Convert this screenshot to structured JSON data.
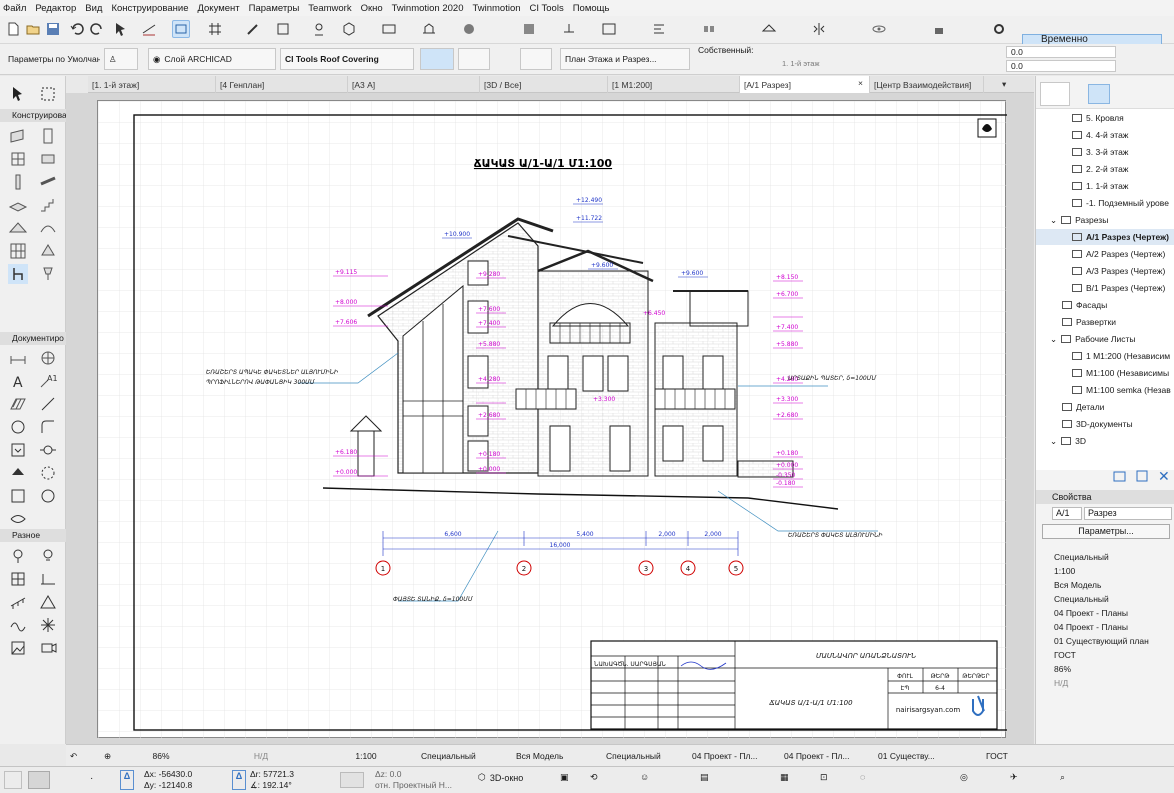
{
  "menu": [
    "Файл",
    "Редактор",
    "Вид",
    "Конструирование",
    "Документ",
    "Параметры",
    "Teamwork",
    "Окно",
    "Twinmotion 2020",
    "Twinmotion",
    "CI Tools",
    "Помощь"
  ],
  "toolbar": {
    "regroup_button": "Временно Разгруппировать"
  },
  "infobox": {
    "defaults": "Параметры по Умолчанию",
    "layer": "Слой ARCHICAD",
    "tool_name": "CI Tools Roof Covering",
    "view_ref": "План Этажа и Разрез...",
    "own_label": "Собственный:",
    "floor": "1. 1-й этаж",
    "field1": "0.0",
    "field2": "0.0"
  },
  "tabs": [
    {
      "label": "[1. 1-й этаж]"
    },
    {
      "label": "[4 Генплан]"
    },
    {
      "label": "[А3 А]"
    },
    {
      "label": "[3D / Все]"
    },
    {
      "label": "[1 М1:200]"
    },
    {
      "label": "[А/1 Разрез]"
    },
    {
      "label": "[Центр Взаимодействия]"
    }
  ],
  "toolbox": {
    "sec1": "Конструирова",
    "sec2": "Документиро",
    "sec3": "Разное"
  },
  "navigator": {
    "items": [
      "5. Кровля",
      "4. 4-й этаж",
      "3. 3-й этаж",
      "2. 2-й этаж",
      "1. 1-й этаж",
      "-1. Подземный урове",
      "Разрезы",
      "А/1 Разрез (Чертеж)",
      "А/2 Разрез (Чертеж)",
      "А/3 Разрез (Чертеж)",
      "В/1 Разрез (Чертеж)",
      "Фасады",
      "Развертки",
      "Рабочие Листы",
      "1 М1:200 (Независим",
      "М1:100 (Независимы",
      "М1:100 semka (Незав",
      "Детали",
      "3D-документы",
      "3D"
    ],
    "properties_title": "Свойства",
    "prop_id": "А/1",
    "prop_name": "Разрез",
    "params_button": "Параметры...",
    "props": [
      "Специальный",
      "1:100",
      "Вся Модель",
      "Специальный",
      "04 Проект - Планы",
      "04 Проект - Планы",
      "01 Существующий план",
      "ГОСТ",
      "86%",
      "Н/Д"
    ]
  },
  "drawing": {
    "title": "ՃԱԿԱՏ Ա/1-Ա/1  Մ1:100",
    "elevations_left": [
      "+9.115",
      "+8.000",
      "+7.606",
      "+6.180",
      "+0.000"
    ],
    "elevations_mid": [
      "+9.280",
      "+7.600",
      "+7.400",
      "+5.880",
      "+4.280",
      "+3.300",
      "+2.680",
      "+0.180",
      "+0.000"
    ],
    "elevations_right": [
      "+8.150",
      "+6.700",
      "+6.450",
      "+7.400",
      "+5.880",
      "+4.280",
      "+3.300",
      "+2.680",
      "+0.180",
      "+0.000",
      "-0.350",
      "-0.180"
    ],
    "roof_marks": [
      "+12.490",
      "+11.722",
      "+10.900",
      "+9.600",
      "+9.600"
    ],
    "note_left_1": "ԵՌԱՇԵՐՏ ԱՊԱԿԵ ՓԱԿԵՏՆԵՐ ԱԼՅՈՒՄԻՆԻ",
    "note_left_2": "ՊՐՈՖԻԼՆԵՐՈՎ ԹԱՓԱՆՑԻԿ 300ՄՄ",
    "note_right": "ԱՐՏԱՔԻՆ ՊԱՏԵՐ, δ=100ՄՄ",
    "note_bottom_right": "ԵՌԱՇԵՐՏ ՓԱԿԵՏ ԱԼՅՈՒՄԻՆԻ",
    "note_bottom": "ՓԱՅՏԵ ՏԱՆԻՔ, δ=100ՄՄ",
    "dims": [
      "6,600",
      "5,400",
      "2,000",
      "2,000"
    ],
    "dim_total": "16,000",
    "axis_marks": [
      "1",
      "2",
      "3",
      "4",
      "5"
    ],
    "stamp": {
      "project": "ՄԱՍՆԱՎՈՐ ԱՌԱՆՁՆԱՏՈՒՆ",
      "drawing": "ՃԱԿԱՏ Ա/1-Ա/1  Մ1:100",
      "author_label": "ՆԱԽԱԳԾ",
      "author": "Ն. ՍԱՐԳՍՅԱՆ",
      "stage_label": "ՓՈՒԼ",
      "sheet_label": "ԹԵՐԹ",
      "sheets_label": "ԹԵՐԹԵՐ",
      "stage": "ԷՊ",
      "sheet": "6-4",
      "website": "nairisargsyan.com"
    }
  },
  "status": {
    "zoom": "86%",
    "angle": "Н/Д",
    "scale": "1:100",
    "layer_combo": "Специальный",
    "model": "Вся Модель",
    "pen": "Специальный",
    "override1": "04 Проект - Пл...",
    "override2": "04 Проект - Пл...",
    "renov": "01 Существу...",
    "dim": "ГОСТ"
  },
  "coords": {
    "dx": "Δx: -56430.0",
    "dy": "Δy: -12140.8",
    "dr": "Δr: 57721.3",
    "da": "∡: 192.14°",
    "dz": "Δz: 0.0",
    "ref": "отн. Проектный Н...",
    "view3d": "3D-окно"
  },
  "colors": {
    "accent": "#cfe4f8",
    "dim_magenta": "#d000d0",
    "dim_blue": "#1f34c8",
    "note_blue": "#3f8fc0"
  }
}
